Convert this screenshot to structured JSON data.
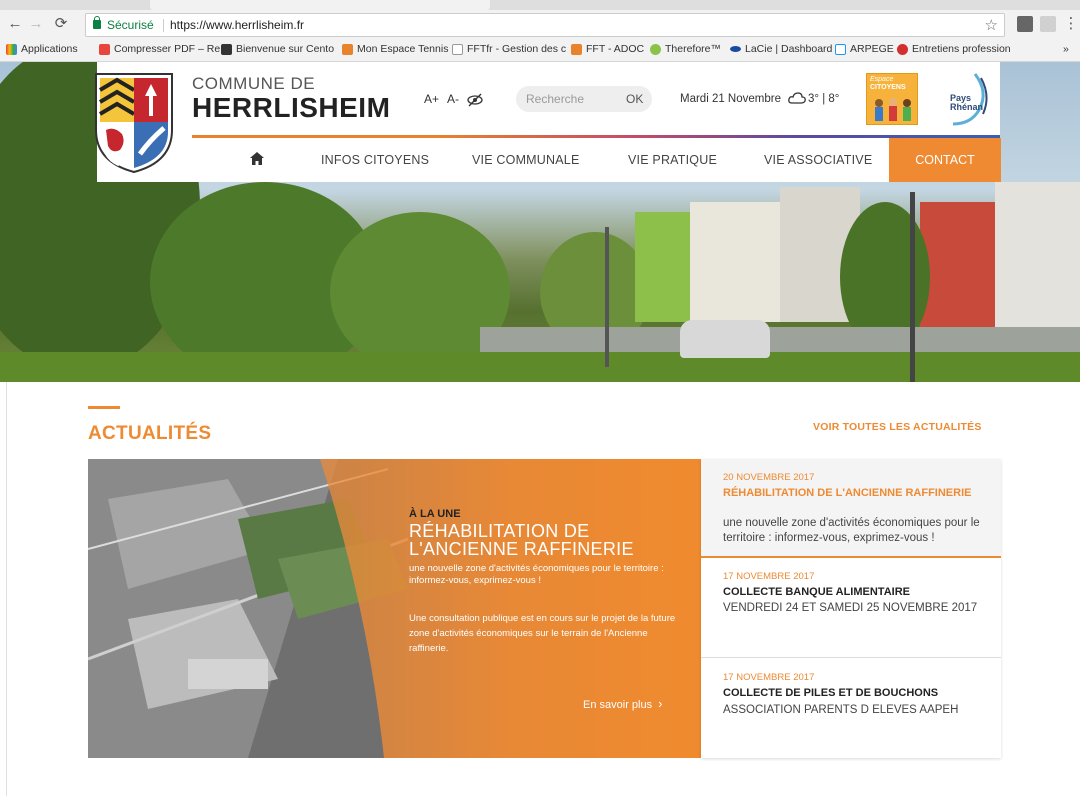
{
  "browser": {
    "secure_label": "Sécurisé",
    "url": "https://www.herrlisheim.fr",
    "bookmarks": [
      {
        "label": "Applications",
        "color": "#4285f4"
      },
      {
        "label": "Compresser PDF – Re",
        "color": "#e8453c"
      },
      {
        "label": "Bienvenue sur Cento",
        "color": "#333333"
      },
      {
        "label": "Mon Espace Tennis",
        "color": "#e8832b"
      },
      {
        "label": "FFTfr - Gestion des c",
        "color": "#999999"
      },
      {
        "label": "FFT - ADOC",
        "color": "#e8832b"
      },
      {
        "label": "Therefore™",
        "color": "#8bc34a"
      },
      {
        "label": "LaCie | Dashboard",
        "color": "#1a4aa0"
      },
      {
        "label": "ARPEGE",
        "color": "#2196f3"
      },
      {
        "label": "Entretiens profession",
        "color": "#d32f2f"
      }
    ],
    "more_label": "»"
  },
  "header": {
    "commune_label": "COMMUNE DE",
    "commune_name": "HERRLISHEIM",
    "font_plus": "A+",
    "font_minus": "A-",
    "search_placeholder": "Recherche",
    "search_ok": "OK",
    "date": "Mardi 21 Novembre",
    "weather": "3° | 8°",
    "espace_logo_line1": "Espace",
    "espace_logo_line2": "CITOYENS",
    "pays_logo_line1": "Pays",
    "pays_logo_line2": "Rhénan"
  },
  "nav": {
    "items": [
      "INFOS CITOYENS",
      "VIE COMMUNALE",
      "VIE PRATIQUE",
      "VIE ASSOCIATIVE"
    ],
    "contact": "CONTACT"
  },
  "news": {
    "section_title": "ACTUALITÉS",
    "see_all": "VOIR TOUTES LES ACTUALITÉS",
    "featured": {
      "kicker": "À LA UNE",
      "title": "RÉHABILITATION DE L'ANCIENNE RAFFINERIE",
      "subtitle": "une nouvelle zone d'activités économiques pour le territoire : informez-vous, exprimez-vous !",
      "body": "Une consultation publique est en cours sur le projet de la future zone d'activités économiques sur le terrain de l'Ancienne raffinerie.",
      "more": "En savoir plus"
    },
    "items": [
      {
        "date": "20 NOVEMBRE 2017",
        "title": "RÉHABILITATION DE L'ANCIENNE RAFFINERIE",
        "desc": "une nouvelle zone d'activités économiques pour le territoire : informez-vous, exprimez-vous !"
      },
      {
        "date": "17 NOVEMBRE 2017",
        "title": "COLLECTE BANQUE ALIMENTAIRE",
        "desc": "VENDREDI 24 ET SAMEDI 25 NOVEMBRE 2017"
      },
      {
        "date": "17 NOVEMBRE 2017",
        "title": "COLLECTE DE PILES ET DE BOUCHONS",
        "desc": "ASSOCIATION PARENTS D ELEVES AAPEH"
      }
    ]
  },
  "colors": {
    "accent": "#ee8a33",
    "contact_bg": "#f08a32",
    "secure_green": "#0b8043"
  }
}
